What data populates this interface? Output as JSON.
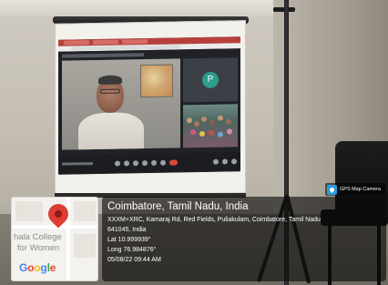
{
  "overlay": {
    "badge": "GPS Map Camera",
    "title": "Coimbatore, Tamil Nadu, India",
    "address_line1": "XXXM+XRC, Kamaraj Rd, Red Fields, Puliakulam, Coimbatore, Tamil Nadu",
    "address_line2": "641045, India",
    "latitude": "Lat 10.999939°",
    "longitude": "Long 76.984876°",
    "datetime": "05/08/22 09:44 AM"
  },
  "map": {
    "place_line1": "hala College",
    "place_line2": "for Women",
    "provider": [
      "G",
      "o",
      "o",
      "g",
      "l",
      "e"
    ],
    "pin_color": "#dd3c33"
  },
  "projection": {
    "participant_initial": "P",
    "browser_tab_color": "#b8403c",
    "end_call_color": "#e0463d"
  }
}
